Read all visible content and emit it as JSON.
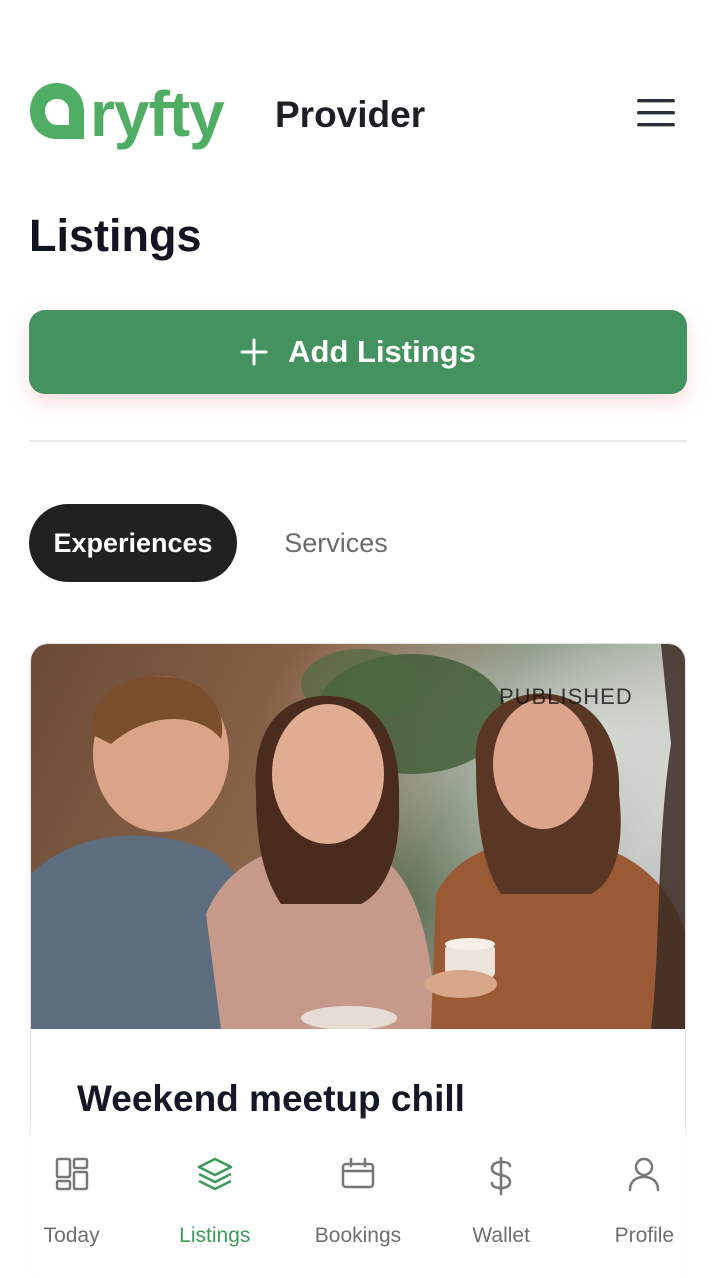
{
  "header": {
    "logo_text": "ryfty",
    "provider_label": "Provider",
    "logo_color": "#4fae63"
  },
  "page": {
    "title": "Listings"
  },
  "actions": {
    "add_label": "Add Listings",
    "add_icon": "plus-icon",
    "accent_color": "#44925f"
  },
  "tabs": [
    {
      "label": "Experiences",
      "active": true
    },
    {
      "label": "Services",
      "active": false
    }
  ],
  "listing": {
    "status": "PUBLISHED",
    "title": "Weekend meetup chill"
  },
  "bottom_nav": {
    "items": [
      {
        "label": "Today",
        "icon": "dashboard-icon"
      },
      {
        "label": "Listings",
        "icon": "layers-icon",
        "active": true
      },
      {
        "label": "Bookings",
        "icon": "calendar-icon"
      },
      {
        "label": "Wallet",
        "icon": "dollar-icon"
      },
      {
        "label": "Profile",
        "icon": "user-icon"
      }
    ],
    "active_color": "#3d9a5c"
  }
}
